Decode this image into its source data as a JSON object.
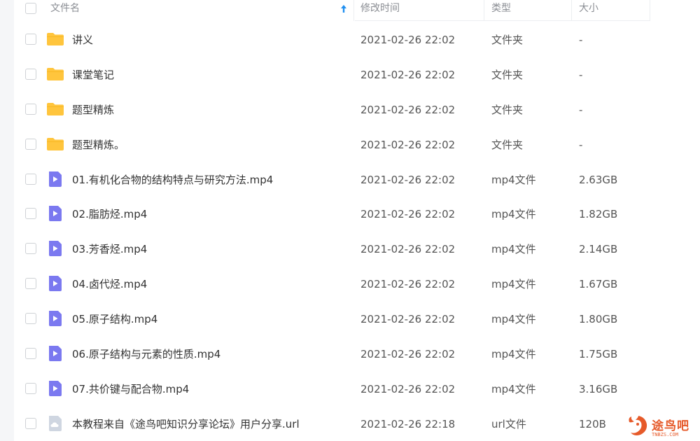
{
  "header": {
    "name": "文件名",
    "modified": "修改时间",
    "type": "类型",
    "size": "大小"
  },
  "sort": {
    "column": "name",
    "direction": "ascending",
    "icon": "arrow-up-icon"
  },
  "colors": {
    "folder": "#ffc53d",
    "video": "#7b79f0",
    "link": "#cfd6e1",
    "sort_arrow": "#1f8ff0",
    "watermark": "#e65a2a"
  },
  "files": [
    {
      "icon": "folder-icon",
      "name": "讲义",
      "modified": "2021-02-26 22:02",
      "type": "文件夹",
      "size": "-"
    },
    {
      "icon": "folder-icon",
      "name": "课堂笔记",
      "modified": "2021-02-26 22:02",
      "type": "文件夹",
      "size": "-"
    },
    {
      "icon": "folder-icon",
      "name": "题型精炼",
      "modified": "2021-02-26 22:02",
      "type": "文件夹",
      "size": "-"
    },
    {
      "icon": "folder-icon",
      "name": "题型精炼。",
      "modified": "2021-02-26 22:02",
      "type": "文件夹",
      "size": "-"
    },
    {
      "icon": "video-file-icon",
      "name": "01.有机化合物的结构特点与研究方法.mp4",
      "modified": "2021-02-26 22:02",
      "type": "mp4文件",
      "size": "2.63GB"
    },
    {
      "icon": "video-file-icon",
      "name": "02.脂肪烃.mp4",
      "modified": "2021-02-26 22:02",
      "type": "mp4文件",
      "size": "1.82GB"
    },
    {
      "icon": "video-file-icon",
      "name": "03.芳香烃.mp4",
      "modified": "2021-02-26 22:02",
      "type": "mp4文件",
      "size": "2.14GB"
    },
    {
      "icon": "video-file-icon",
      "name": "04.卤代烃.mp4",
      "modified": "2021-02-26 22:02",
      "type": "mp4文件",
      "size": "1.67GB"
    },
    {
      "icon": "video-file-icon",
      "name": "05.原子结构.mp4",
      "modified": "2021-02-26 22:02",
      "type": "mp4文件",
      "size": "1.80GB"
    },
    {
      "icon": "video-file-icon",
      "name": "06.原子结构与元素的性质.mp4",
      "modified": "2021-02-26 22:02",
      "type": "mp4文件",
      "size": "1.75GB"
    },
    {
      "icon": "video-file-icon",
      "name": "07.共价键与配合物.mp4",
      "modified": "2021-02-26 22:02",
      "type": "mp4文件",
      "size": "3.16GB"
    },
    {
      "icon": "link-file-icon",
      "name": "本教程来自《途鸟吧知识分享论坛》用户分享.url",
      "modified": "2021-02-26 22:18",
      "type": "url文件",
      "size": "120B"
    }
  ],
  "watermark": {
    "text": "途鸟吧",
    "subtext": "TNBZS.COM",
    "icon": "bird-logo-icon"
  }
}
